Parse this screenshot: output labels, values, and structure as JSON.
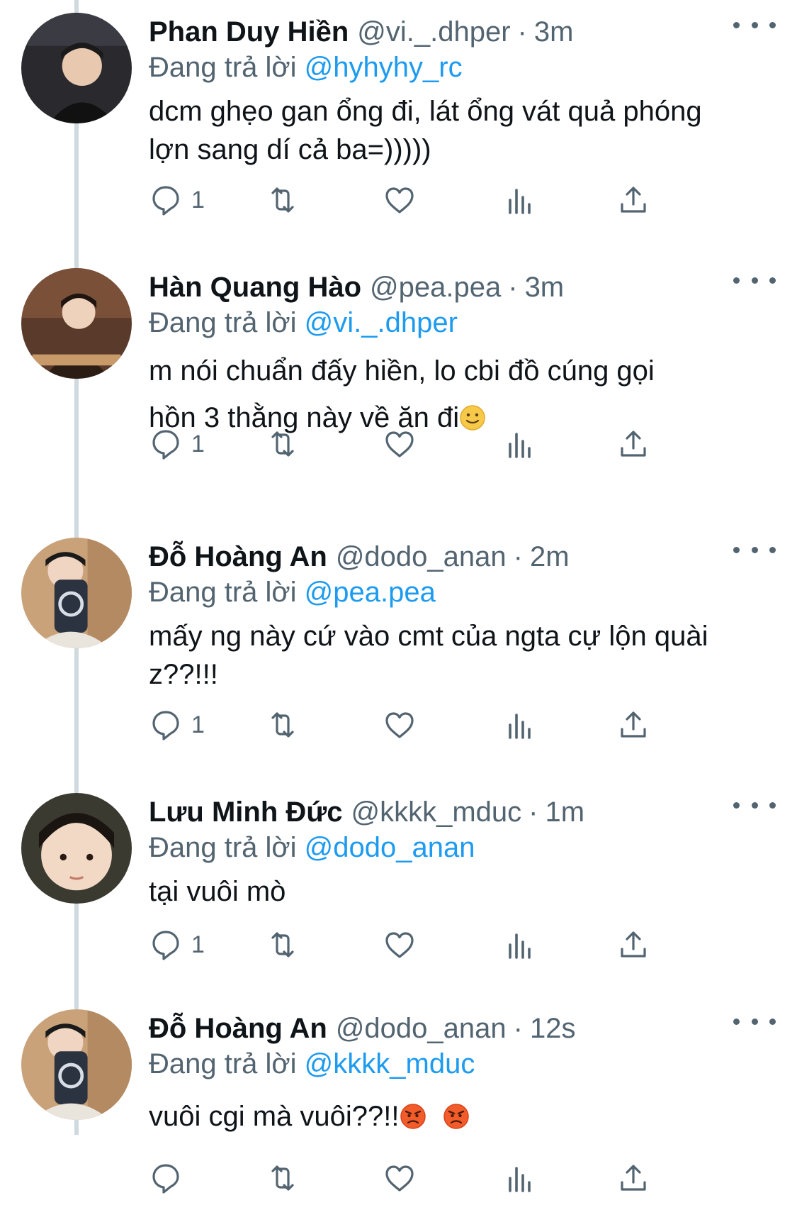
{
  "tweets": [
    {
      "name": "Phan Duy Hiền",
      "handle": "@vi._.dhper",
      "time": "3m",
      "reply_prefix": "Đang trả lời ",
      "reply_to": "@hyhyhy_rc",
      "text_lines": [
        "dcm ghẹo gan ổng đi, lát ổng vát quả phóng",
        "lợn sang dí cả ba=)))))"
      ],
      "reply_count": "1"
    },
    {
      "name": "Hàn Quang Hào",
      "handle": "@pea.pea",
      "time": "3m",
      "reply_prefix": "Đang trả lời ",
      "reply_to": "@vi._.dhper",
      "text_lines": [
        "m nói chuẩn đấy hiền, lo cbi đồ cúng gọi",
        "hồn 3 thằng này về ăn đi"
      ],
      "emojis": [
        "slightly-smiling-face"
      ],
      "reply_count": "1"
    },
    {
      "name": "Đỗ Hoàng An",
      "handle": "@dodo_anan",
      "time": "2m",
      "reply_prefix": "Đang trả lời ",
      "reply_to": "@pea.pea",
      "text_lines": [
        "mấy ng này cứ vào cmt của ngta cự lộn quài",
        "z??!!!"
      ],
      "reply_count": "1"
    },
    {
      "name": "Lưu Minh Đức",
      "handle": "@kkkk_mduc",
      "time": "1m",
      "reply_prefix": "Đang trả lời ",
      "reply_to": "@dodo_anan",
      "text_lines": [
        "tại vuôi mò"
      ],
      "reply_count": "1"
    },
    {
      "name": "Đỗ Hoàng An",
      "handle": "@dodo_anan",
      "time": "12s",
      "reply_prefix": "Đang trả lời ",
      "reply_to": "@kkkk_mduc",
      "text_lines": [
        "vuôi cgi mà vuôi??!!"
      ],
      "emojis": [
        "angry-face",
        "angry-face"
      ],
      "reply_count": ""
    }
  ],
  "separator": "·",
  "colors": {
    "text": "#0f1419",
    "secondary": "#536471",
    "link": "#1d9bf0",
    "thread_line": "#cfd9de"
  },
  "icons": [
    "reply-icon",
    "retweet-icon",
    "like-icon",
    "analytics-icon",
    "share-icon",
    "more-icon"
  ]
}
